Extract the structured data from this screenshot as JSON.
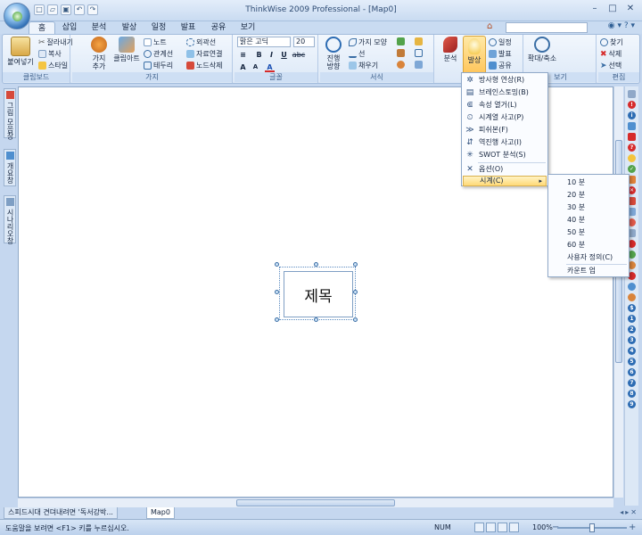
{
  "window": {
    "title": "ThinkWise 2009 Professional - [Map0]",
    "minimize": "–",
    "maximize": "□",
    "close": "✕"
  },
  "ribbon_tabs": [
    "홈",
    "삽입",
    "분석",
    "발상",
    "일정",
    "발표",
    "공유",
    "보기"
  ],
  "help": "◉ ▾ ? ▾",
  "ribbon": {
    "clipboard": {
      "label": "클립보드",
      "paste": "붙여넣기",
      "cut": "잘라내기",
      "copy": "복사",
      "style": "스타일"
    },
    "branch": {
      "label": "가지",
      "add_branch": "가지 추가",
      "clipart": "클립아트",
      "note": "노트",
      "relation": "관계선",
      "border": "테두리",
      "boundary": "외곽선",
      "data_link": "자료연결",
      "delete_node": "노드삭제"
    },
    "font": {
      "label": "글꼴",
      "font_name": "맑은 고딕",
      "font_size": "20",
      "bold": "B",
      "italic": "I",
      "underline": "U",
      "strike": "abc"
    },
    "format": {
      "label": "서식",
      "direction": "진행 방향",
      "branch_shape": "가지 모양",
      "line": "선",
      "fill": "채우기"
    },
    "idea": {
      "analyze": "분석",
      "ideate": "발상",
      "schedule": "일정",
      "present": "발표",
      "share": "공유"
    },
    "view": {
      "label": "보기",
      "zoom": "확대/축소"
    },
    "edit": {
      "label": "편집",
      "find": "찾기",
      "delete": "삭제",
      "select": "선택"
    }
  },
  "left_tabs": [
    "그림 모음창",
    "개요창",
    "시나리오창"
  ],
  "canvas": {
    "topic": "제목"
  },
  "menu": {
    "items": [
      {
        "label": "방사형 연상(R)",
        "icon": "radial-icon",
        "glyph": "✲"
      },
      {
        "label": "브레인스토밍(B)",
        "icon": "brainstorm-icon",
        "glyph": "▤"
      },
      {
        "label": "속성 열거(L)",
        "icon": "attribute-icon",
        "glyph": "⋐"
      },
      {
        "label": "시계열 사고(P)",
        "icon": "timeseries-icon",
        "glyph": "⏲"
      },
      {
        "label": "피쉬본(F)",
        "icon": "fishbone-icon",
        "glyph": "≫"
      },
      {
        "label": "역진행 사고(I)",
        "icon": "reverse-icon",
        "glyph": "⇵"
      },
      {
        "label": "SWOT 분석(S)",
        "icon": "swot-icon",
        "glyph": "✳"
      }
    ],
    "options": "옵션(O)",
    "timer": "시계(C)"
  },
  "submenu": {
    "items": [
      "10 분",
      "20 분",
      "30 분",
      "40 분",
      "50 분",
      "60 분",
      "사용자 정의(C)"
    ],
    "countup": "카운트 업"
  },
  "doc_tabs": [
    "스피드시대 견뎌내려면 '독서강박...",
    "Map0"
  ],
  "status": {
    "help": "도움말을 보려면 <F1> 키를 누르십시오.",
    "num": "NUM",
    "zoom": "100%"
  },
  "colors": {
    "accent": "#c9dbf1",
    "highlight": "#ffd977"
  }
}
